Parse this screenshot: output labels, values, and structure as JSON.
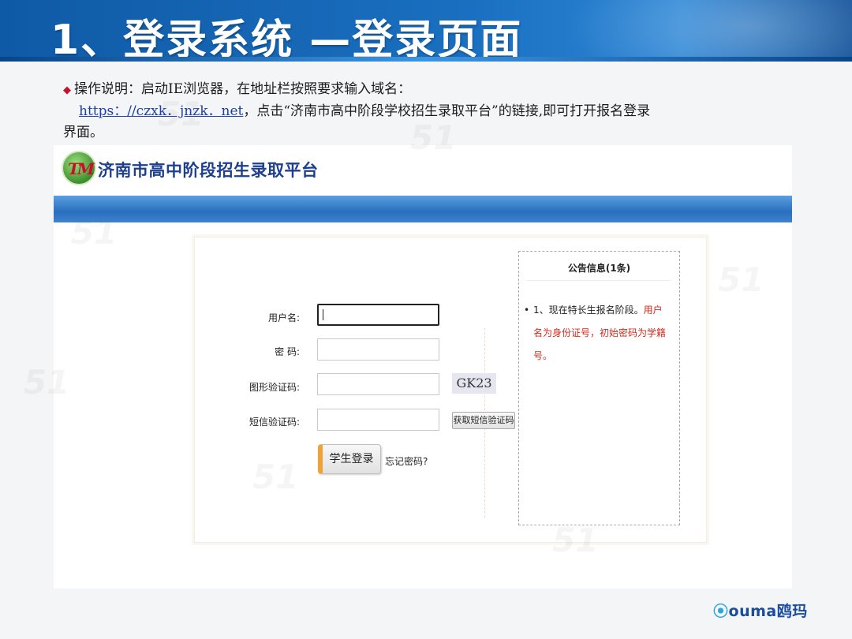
{
  "slide": {
    "title": "1、登录系统 —登录页面"
  },
  "instructions": {
    "bullet": "◆",
    "line1": "操作说明：启动IE浏览器，在地址栏按照要求输入域名：",
    "url": "https：//czxk．jnzk．net",
    "line2_rest": "，点击“济南市高中阶段学校招生录取平台”的链接,即可打开报名登录",
    "line3": "界面。"
  },
  "site": {
    "name": "济南市高中阶段招生录取平台"
  },
  "login": {
    "username_label": "用户名:",
    "password_label": "密 码:",
    "captcha_label": "图形验证码:",
    "sms_label": "短信验证码:",
    "captcha_text": "GK23",
    "sms_button": "获取短信验证码",
    "login_button": "学生登录",
    "forgot_link": "忘记密码?"
  },
  "notice": {
    "title": "公告信息(1条)",
    "item_prefix": "1、现在特长生报名阶段。",
    "item_highlight": "用户名为身份证号，初始密码为学籍号。"
  },
  "brand": {
    "logo_text": "ouma",
    "logo_cn": "鸥玛"
  }
}
